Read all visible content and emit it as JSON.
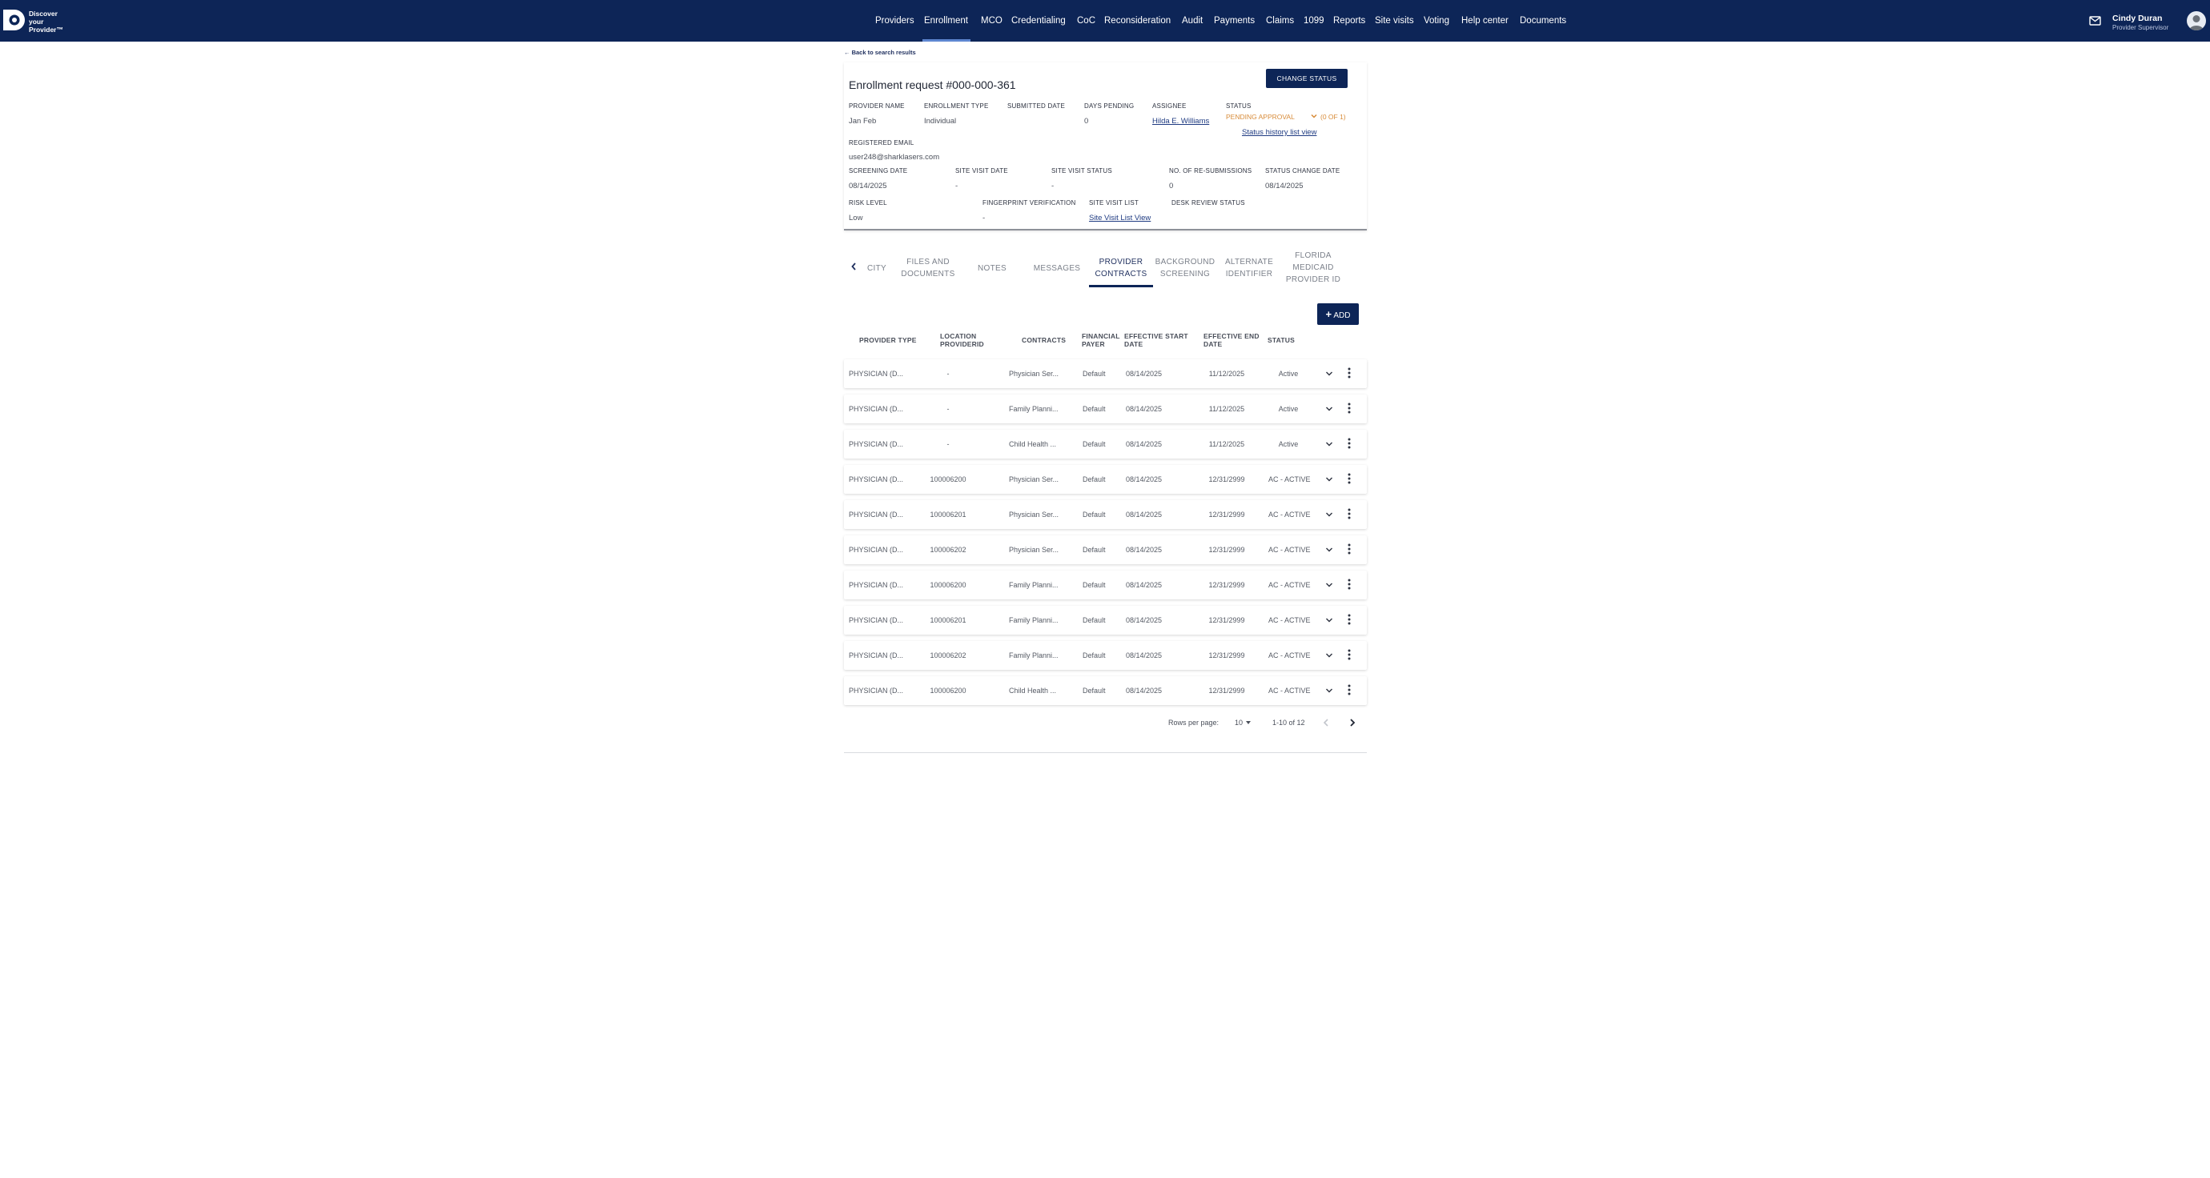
{
  "brand": {
    "line1": "Discover",
    "line2": "your",
    "line3": "Provider™",
    "logo_icon": "discover-logo-icon"
  },
  "nav": {
    "items": [
      "Providers",
      "Enrollment",
      "MCO",
      "Credentialing",
      "CoC",
      "Reconsideration",
      "Audit",
      "Payments",
      "Claims",
      "1099",
      "Reports",
      "Site visits",
      "Voting",
      "Help center",
      "Documents"
    ],
    "active": "Enrollment"
  },
  "user": {
    "name": "Cindy Duran",
    "role": "Provider Supervisor",
    "mail_icon": "mail-icon",
    "avatar_icon": "avatar-icon"
  },
  "back_link": "← Back to search results",
  "request": {
    "title": "Enrollment request #000-000-361",
    "change_status_label": "CHANGE STATUS",
    "fields": {
      "provider_name": {
        "label": "PROVIDER NAME",
        "value": "Jan Feb"
      },
      "enrollment_type": {
        "label": "ENROLLMENT TYPE",
        "value": "Individual"
      },
      "submitted_date": {
        "label": "SUBMITTED DATE",
        "value": ""
      },
      "days_pending": {
        "label": "DAYS PENDING",
        "value": "0"
      },
      "assignee": {
        "label": "ASSIGNEE",
        "value": "Hilda E. Williams"
      },
      "status": {
        "label": "STATUS",
        "value": "PENDING APPROVAL",
        "count": "(0 OF 1)",
        "history_link": "Status history list view"
      },
      "registered_email": {
        "label": "REGISTERED EMAIL",
        "value": "user248@sharklasers.com"
      },
      "screening_date": {
        "label": "SCREENING DATE",
        "value": "08/14/2025"
      },
      "site_visit_date": {
        "label": "SITE VISIT DATE",
        "value": "-"
      },
      "site_visit_status": {
        "label": "SITE VISIT STATUS",
        "value": "-"
      },
      "resubmissions": {
        "label": "NO. OF RE-SUBMISSIONS",
        "value": "0"
      },
      "status_change_date": {
        "label": "STATUS CHANGE DATE",
        "value": "08/14/2025"
      },
      "risk_level": {
        "label": "RISK LEVEL",
        "value": "Low"
      },
      "fingerprint": {
        "label": "FINGERPRINT VERIFICATION",
        "value": "-"
      },
      "site_visit_list": {
        "label": "SITE VISIT LIST",
        "value": "Site Visit List View"
      },
      "desk_review_status": {
        "label": "DESK REVIEW STATUS",
        "value": ""
      }
    }
  },
  "tabs": {
    "items": [
      {
        "line1": "CITY",
        "line2": "",
        "line3": ""
      },
      {
        "line1": "FILES AND",
        "line2": "DOCUMENTS",
        "line3": ""
      },
      {
        "line1": "NOTES",
        "line2": "",
        "line3": ""
      },
      {
        "line1": "MESSAGES",
        "line2": "",
        "line3": ""
      },
      {
        "line1": "PROVIDER",
        "line2": "CONTRACTS",
        "line3": ""
      },
      {
        "line1": "BACKGROUND",
        "line2": "SCREENING",
        "line3": ""
      },
      {
        "line1": "ALTERNATE",
        "line2": "IDENTIFIER",
        "line3": ""
      },
      {
        "line1": "FLORIDA",
        "line2": "MEDICAID",
        "line3": "PROVIDER ID"
      }
    ],
    "active_index": 4
  },
  "add_label": "ADD",
  "table": {
    "headers": {
      "provider_type": "PROVIDER TYPE",
      "location_1": "LOCATION",
      "location_2": "PROVIDERID",
      "contracts": "CONTRACTS",
      "payer_1": "FINANCIAL",
      "payer_2": "PAYER",
      "start_1": "EFFECTIVE START",
      "start_2": "DATE",
      "end_1": "EFFECTIVE END",
      "end_2": "DATE",
      "status": "STATUS"
    },
    "rows": [
      {
        "provider_type": "PHYSICIAN (D...",
        "location": "-",
        "contract": "Physician Ser...",
        "payer": "Default",
        "start": "08/14/2025",
        "end": "11/12/2025",
        "status": "Active"
      },
      {
        "provider_type": "PHYSICIAN (D...",
        "location": "-",
        "contract": "Family Planni...",
        "payer": "Default",
        "start": "08/14/2025",
        "end": "11/12/2025",
        "status": "Active"
      },
      {
        "provider_type": "PHYSICIAN (D...",
        "location": "-",
        "contract": "Child Health ...",
        "payer": "Default",
        "start": "08/14/2025",
        "end": "11/12/2025",
        "status": "Active"
      },
      {
        "provider_type": "PHYSICIAN (D...",
        "location": "100006200",
        "contract": "Physician Ser...",
        "payer": "Default",
        "start": "08/14/2025",
        "end": "12/31/2999",
        "status": "AC - ACTIVE"
      },
      {
        "provider_type": "PHYSICIAN (D...",
        "location": "100006201",
        "contract": "Physician Ser...",
        "payer": "Default",
        "start": "08/14/2025",
        "end": "12/31/2999",
        "status": "AC - ACTIVE"
      },
      {
        "provider_type": "PHYSICIAN (D...",
        "location": "100006202",
        "contract": "Physician Ser...",
        "payer": "Default",
        "start": "08/14/2025",
        "end": "12/31/2999",
        "status": "AC - ACTIVE"
      },
      {
        "provider_type": "PHYSICIAN (D...",
        "location": "100006200",
        "contract": "Family Planni...",
        "payer": "Default",
        "start": "08/14/2025",
        "end": "12/31/2999",
        "status": "AC - ACTIVE"
      },
      {
        "provider_type": "PHYSICIAN (D...",
        "location": "100006201",
        "contract": "Family Planni...",
        "payer": "Default",
        "start": "08/14/2025",
        "end": "12/31/2999",
        "status": "AC - ACTIVE"
      },
      {
        "provider_type": "PHYSICIAN (D...",
        "location": "100006202",
        "contract": "Family Planni...",
        "payer": "Default",
        "start": "08/14/2025",
        "end": "12/31/2999",
        "status": "AC - ACTIVE"
      },
      {
        "provider_type": "PHYSICIAN (D...",
        "location": "100006200",
        "contract": "Child Health ...",
        "payer": "Default",
        "start": "08/14/2025",
        "end": "12/31/2999",
        "status": "AC - ACTIVE"
      }
    ]
  },
  "pagination": {
    "rows_per_page_label": "Rows per page:",
    "rows_per_page": "10",
    "range": "1-10 of 12"
  },
  "colors": {
    "navy": "#0d2557",
    "status_pending": "#d88c3a",
    "link": "#1f3b82"
  }
}
